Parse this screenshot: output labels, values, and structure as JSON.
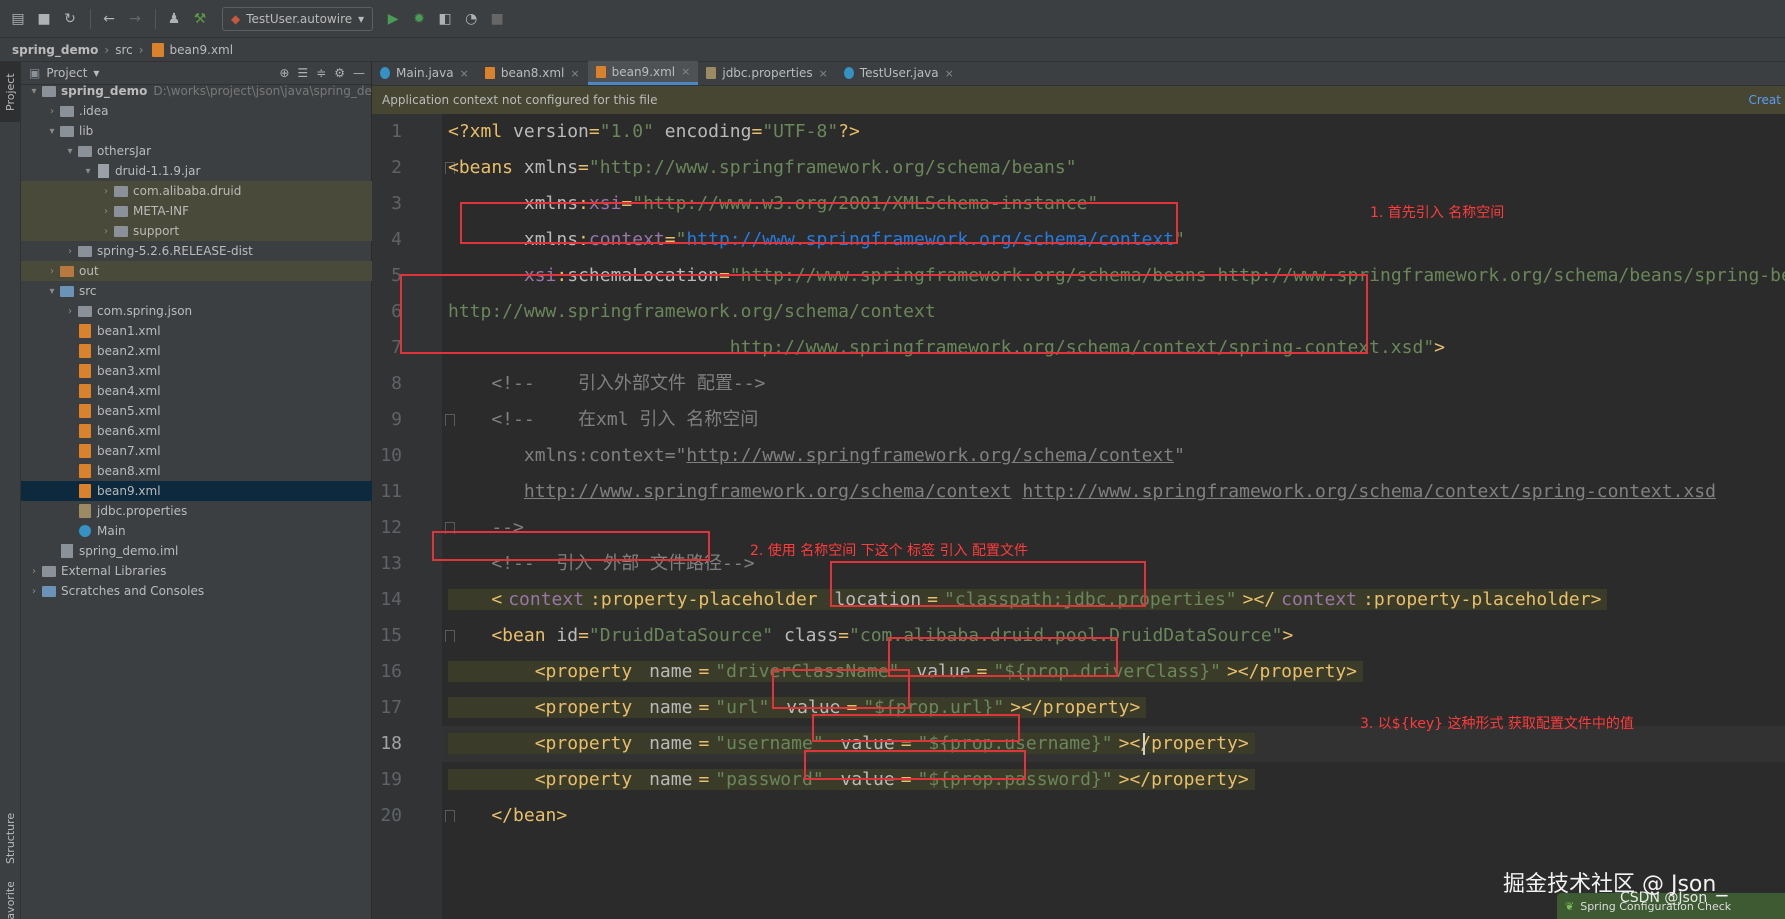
{
  "toolbar": {
    "run_config": "TestUser.autowire",
    "run_config_arrow": "▾"
  },
  "breadcrumb": [
    "spring_demo",
    "src",
    "bean9.xml"
  ],
  "side_tabs": {
    "project": "Project",
    "structure": "Structure",
    "favorites": "Favorites"
  },
  "project_panel": {
    "title": "Project",
    "tree": [
      {
        "label": "spring_demo",
        "note": "D:\\works\\project\\json\\java\\spring_de",
        "depth": 0,
        "arrow": "down",
        "icon": "module-folder",
        "bold": true
      },
      {
        "label": ".idea",
        "depth": 1,
        "arrow": "right",
        "icon": "folder"
      },
      {
        "label": "lib",
        "depth": 1,
        "arrow": "down",
        "icon": "folder"
      },
      {
        "label": "othersJar",
        "depth": 2,
        "arrow": "down",
        "icon": "folder"
      },
      {
        "label": "druid-1.1.9.jar",
        "depth": 3,
        "arrow": "down",
        "icon": "jar"
      },
      {
        "label": "com.alibaba.druid",
        "depth": 4,
        "arrow": "right",
        "icon": "folder",
        "hl": true
      },
      {
        "label": "META-INF",
        "depth": 4,
        "arrow": "right",
        "icon": "folder",
        "hl": true
      },
      {
        "label": "support",
        "depth": 4,
        "arrow": "right",
        "icon": "folder",
        "hl": true
      },
      {
        "label": "spring-5.2.6.RELEASE-dist",
        "depth": 2,
        "arrow": "right",
        "icon": "folder"
      },
      {
        "label": "out",
        "depth": 1,
        "arrow": "right",
        "icon": "folder-orange",
        "hl": true
      },
      {
        "label": "src",
        "depth": 1,
        "arrow": "down",
        "icon": "folder-blue"
      },
      {
        "label": "com.spring.json",
        "depth": 2,
        "arrow": "right",
        "icon": "folder"
      },
      {
        "label": "bean1.xml",
        "depth": 2,
        "icon": "xml"
      },
      {
        "label": "bean2.xml",
        "depth": 2,
        "icon": "xml"
      },
      {
        "label": "bean3.xml",
        "depth": 2,
        "icon": "xml"
      },
      {
        "label": "bean4.xml",
        "depth": 2,
        "icon": "xml"
      },
      {
        "label": "bean5.xml",
        "depth": 2,
        "icon": "xml"
      },
      {
        "label": "bean6.xml",
        "depth": 2,
        "icon": "xml"
      },
      {
        "label": "bean7.xml",
        "depth": 2,
        "icon": "xml"
      },
      {
        "label": "bean8.xml",
        "depth": 2,
        "icon": "xml"
      },
      {
        "label": "bean9.xml",
        "depth": 2,
        "icon": "xml",
        "selected": true
      },
      {
        "label": "jdbc.properties",
        "depth": 2,
        "icon": "properties"
      },
      {
        "label": "Main",
        "depth": 2,
        "icon": "java"
      },
      {
        "label": "spring_demo.iml",
        "depth": 1,
        "icon": "iml"
      },
      {
        "label": "External Libraries",
        "depth": 0,
        "arrow": "right",
        "icon": "libraries"
      },
      {
        "label": "Scratches and Consoles",
        "depth": 0,
        "arrow": "right",
        "icon": "scratches"
      }
    ]
  },
  "tabs": [
    {
      "label": "Main.java",
      "icon": "java",
      "active": false
    },
    {
      "label": "bean8.xml",
      "icon": "xml",
      "active": false
    },
    {
      "label": "bean9.xml",
      "icon": "xml",
      "active": true
    },
    {
      "label": "jdbc.properties",
      "icon": "properties",
      "active": false
    },
    {
      "label": "TestUser.java",
      "icon": "java",
      "active": false
    }
  ],
  "banner": {
    "text": "Application context not configured for this file",
    "action": "Creat"
  },
  "current_line": 18,
  "code_lines": [
    {
      "n": 1,
      "segs": [
        [
          "t",
          "<?xml "
        ],
        [
          "a",
          "version"
        ],
        [
          "t",
          "="
        ],
        [
          "v",
          "\"1.0\""
        ],
        [
          "a",
          " encoding"
        ],
        [
          "t",
          "="
        ],
        [
          "v",
          "\"UTF-8\""
        ],
        [
          "t",
          "?>"
        ]
      ]
    },
    {
      "n": 2,
      "segs": [
        [
          "t",
          "<beans "
        ],
        [
          "a",
          "xmlns"
        ],
        [
          "t",
          "="
        ],
        [
          "v",
          "\"http://www.springframework.org/schema/beans\""
        ]
      ]
    },
    {
      "n": 3,
      "segs": [
        [
          "a",
          "       xmlns"
        ],
        [
          "t",
          ":"
        ],
        [
          "n",
          "xsi"
        ],
        [
          "t",
          "="
        ],
        [
          "v",
          "\"http://www.w3.org/2001/XMLSchema-instance\""
        ]
      ]
    },
    {
      "n": 4,
      "segs": [
        [
          "a",
          "       xmlns"
        ],
        [
          "t",
          ":"
        ],
        [
          "n",
          "context"
        ],
        [
          "t",
          "="
        ],
        [
          "v",
          "\""
        ],
        [
          "l",
          "http://www.springframework.org/schema/context"
        ],
        [
          "v",
          "\""
        ]
      ]
    },
    {
      "n": 5,
      "segs": [
        [
          "n",
          "       xsi"
        ],
        [
          "t",
          ":"
        ],
        [
          "a",
          "schemaLocation"
        ],
        [
          "t",
          "="
        ],
        [
          "v",
          "\"http://www.springframework.org/schema/beans http://www.springframework.org/schema/beans/spring-beans.xsd"
        ]
      ]
    },
    {
      "n": 6,
      "segs": [
        [
          "v",
          "http://www.springframework.org/schema/context"
        ]
      ]
    },
    {
      "n": 7,
      "segs": [
        [
          "v",
          "                          http://www.springframework.org/schema/context/spring-context.xsd\""
        ],
        [
          "t",
          ">"
        ]
      ]
    },
    {
      "n": 8,
      "segs": [
        [
          "c",
          "    <!--    引入外部文件 配置-->"
        ]
      ]
    },
    {
      "n": 9,
      "segs": [
        [
          "c",
          "    <!--    在xml 引入 名称空间"
        ]
      ]
    },
    {
      "n": 10,
      "segs": [
        [
          "c",
          "       xmlns:context=\""
        ],
        [
          "u",
          "http://www.springframework.org/schema/context"
        ],
        [
          "c",
          "\""
        ]
      ]
    },
    {
      "n": 11,
      "segs": [
        [
          "c",
          "       "
        ],
        [
          "u",
          "http://www.springframework.org/schema/context"
        ],
        [
          "c",
          " "
        ],
        [
          "u",
          "http://www.springframework.org/schema/context/spring-context.xsd"
        ]
      ]
    },
    {
      "n": 12,
      "segs": [
        [
          "c",
          "    -->"
        ]
      ]
    },
    {
      "n": 13,
      "segs": [
        [
          "c",
          "    <!--  引入 外部 文件路径-->"
        ]
      ]
    },
    {
      "n": 14,
      "hl": true,
      "segs": [
        [
          "t",
          "    <"
        ],
        [
          "n",
          "context"
        ],
        [
          "t",
          ":property-placeholder "
        ],
        [
          "a",
          "location"
        ],
        [
          "t",
          "="
        ],
        [
          "v",
          "\"classpath:jdbc.properties\""
        ],
        [
          "t",
          "></"
        ],
        [
          "n",
          "context"
        ],
        [
          "t",
          ":property-placeholder>"
        ]
      ]
    },
    {
      "n": 15,
      "segs": [
        [
          "t",
          "    <bean "
        ],
        [
          "a",
          "id"
        ],
        [
          "t",
          "="
        ],
        [
          "v",
          "\"DruidDataSource\""
        ],
        [
          "a",
          " class"
        ],
        [
          "t",
          "="
        ],
        [
          "v",
          "\"com.alibaba.druid.pool.DruidDataSource\""
        ],
        [
          "t",
          ">"
        ]
      ]
    },
    {
      "n": 16,
      "hl": true,
      "segs": [
        [
          "t",
          "        <property "
        ],
        [
          "a",
          "name"
        ],
        [
          "t",
          "="
        ],
        [
          "v",
          "\"driverClassName\""
        ],
        [
          "a",
          " value"
        ],
        [
          "t",
          "="
        ],
        [
          "v",
          "\"${prop.driverClass}\""
        ],
        [
          "t",
          "></property>"
        ]
      ]
    },
    {
      "n": 17,
      "hl": true,
      "segs": [
        [
          "t",
          "        <property "
        ],
        [
          "a",
          "name"
        ],
        [
          "t",
          "="
        ],
        [
          "v",
          "\"url\""
        ],
        [
          "a",
          " value"
        ],
        [
          "t",
          "="
        ],
        [
          "v",
          "\"${prop.url}\""
        ],
        [
          "t",
          "></property>"
        ]
      ]
    },
    {
      "n": 18,
      "hl": true,
      "segs": [
        [
          "t",
          "        <property "
        ],
        [
          "a",
          "name"
        ],
        [
          "t",
          "="
        ],
        [
          "v",
          "\"username\""
        ],
        [
          "a",
          " value"
        ],
        [
          "t",
          "="
        ],
        [
          "v",
          "\"${prop.username}\""
        ],
        [
          "t",
          "></property>"
        ]
      ]
    },
    {
      "n": 19,
      "hl": true,
      "segs": [
        [
          "t",
          "        <property "
        ],
        [
          "a",
          "name"
        ],
        [
          "t",
          "="
        ],
        [
          "v",
          "\"password\""
        ],
        [
          "a",
          " value"
        ],
        [
          "t",
          "="
        ],
        [
          "v",
          "\"${prop.password}\""
        ],
        [
          "t",
          "></property>"
        ]
      ]
    },
    {
      "n": 20,
      "segs": [
        [
          "t",
          "    </bean>"
        ]
      ]
    }
  ],
  "annotations": [
    "1. 首先引入 名称空间",
    "2. 使用 名称空间 下这个 标签 引入 配置文件",
    "3. 以${key} 这种形式 获取配置文件中的值"
  ],
  "status": {
    "spring_check": "Spring Configuration Check"
  },
  "watermark": {
    "main": "掘金技术社区 @ Json_",
    "sub": "CSDN @Json"
  },
  "colors": {
    "tag": "#e8bf6a",
    "attribute": "#bababa",
    "namespace": "#9876aa",
    "string": "#6a8759",
    "link": "#287bde",
    "comment": "#808080",
    "annotation_red": "#e0333a",
    "selection": "#0d293e",
    "banner": "#474633"
  }
}
